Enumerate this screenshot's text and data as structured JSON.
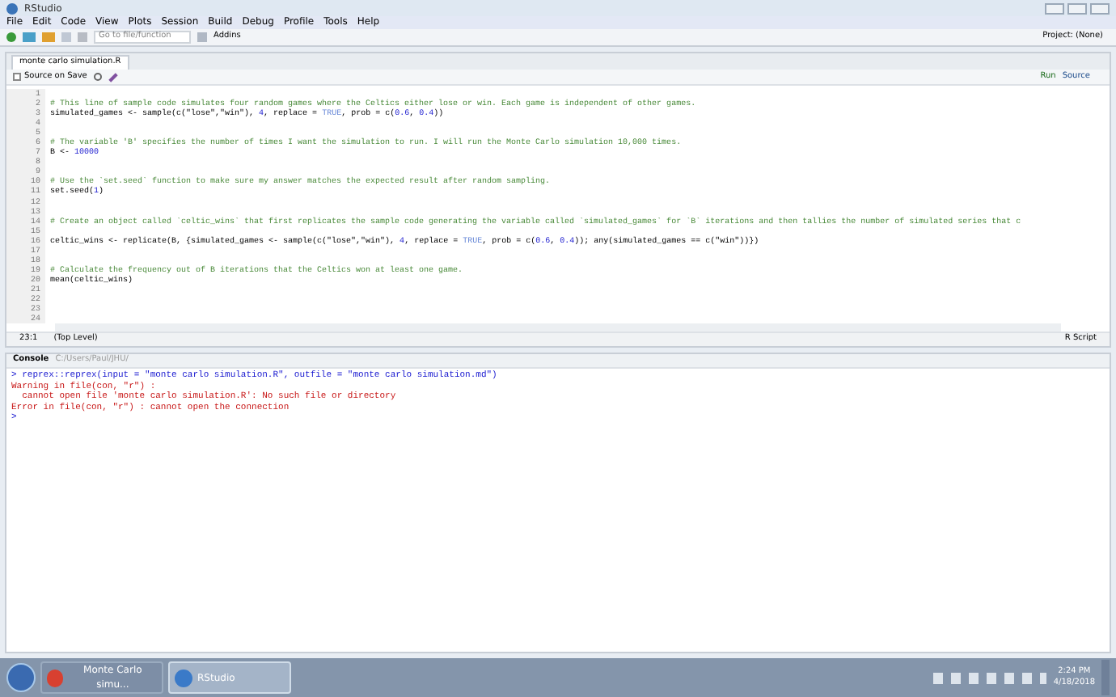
{
  "window": {
    "title": "RStudio"
  },
  "menu": [
    "File",
    "Edit",
    "Code",
    "View",
    "Plots",
    "Session",
    "Build",
    "Debug",
    "Profile",
    "Tools",
    "Help"
  ],
  "toolbar": {
    "goto_placeholder": "Go to file/function",
    "addins": "Addins",
    "project": "Project: (None)"
  },
  "editor": {
    "tab": {
      "label": "monte carlo simulation.R",
      "selected": true
    },
    "source_on_save": {
      "label": "Source on Save",
      "checked": false
    },
    "run": "Run",
    "source": "Source",
    "lines": [
      {
        "number": "1"
      },
      {
        "number": "2",
        "segments": [
          {
            "kind": "comment",
            "text": "# This line of sample code simulates four random games where the Celtics either lose or win. Each game is independent of other games."
          }
        ]
      },
      {
        "number": "3",
        "segments": [
          {
            "kind": "code",
            "text": "simulated_games <- sample(c(\"lose\",\"win\"), "
          },
          {
            "kind": "number",
            "text": "4"
          },
          {
            "kind": "code",
            "text": ", replace = "
          },
          {
            "kind": "constant",
            "text": "TRUE"
          },
          {
            "kind": "code",
            "text": ", prob = c("
          },
          {
            "kind": "number",
            "text": "0.6"
          },
          {
            "kind": "code",
            "text": ", "
          },
          {
            "kind": "number",
            "text": "0.4"
          },
          {
            "kind": "code",
            "text": "))"
          }
        ]
      },
      {
        "number": "4"
      },
      {
        "number": "5"
      },
      {
        "number": "6",
        "segments": [
          {
            "kind": "comment",
            "text": "# The variable 'B' specifies the number of times I want the simulation to run. I will run the Monte Carlo simulation 10,000 times."
          }
        ]
      },
      {
        "number": "7",
        "segments": [
          {
            "kind": "code",
            "text": "B <- "
          },
          {
            "kind": "number",
            "text": "10000"
          }
        ]
      },
      {
        "number": "8"
      },
      {
        "number": "9"
      },
      {
        "number": "10",
        "segments": [
          {
            "kind": "comment",
            "text": "# Use the `set.seed` function to make sure my answer matches the expected result after random sampling."
          }
        ]
      },
      {
        "number": "11",
        "segments": [
          {
            "kind": "code",
            "text": "set.seed("
          },
          {
            "kind": "number",
            "text": "1"
          },
          {
            "kind": "code",
            "text": ")"
          }
        ]
      },
      {
        "number": "12"
      },
      {
        "number": "13"
      },
      {
        "number": "14",
        "segments": [
          {
            "kind": "comment",
            "text": "# Create an object called `celtic_wins` that first replicates the sample code generating the variable called `simulated_games` for `B` iterations and then tallies the number of simulated series that c"
          }
        ]
      },
      {
        "number": "15"
      },
      {
        "number": "16",
        "segments": [
          {
            "kind": "code",
            "text": "celtic_wins <- replicate(B, {simulated_games <- sample(c(\"lose\",\"win\"), "
          },
          {
            "kind": "number",
            "text": "4"
          },
          {
            "kind": "code",
            "text": ", replace = "
          },
          {
            "kind": "constant",
            "text": "TRUE"
          },
          {
            "kind": "code",
            "text": ", prob = c("
          },
          {
            "kind": "number",
            "text": "0.6"
          },
          {
            "kind": "code",
            "text": ", "
          },
          {
            "kind": "number",
            "text": "0.4"
          },
          {
            "kind": "code",
            "text": ")); any(simulated_games == c(\"win\"))})"
          }
        ]
      },
      {
        "number": "17"
      },
      {
        "number": "18"
      },
      {
        "number": "19",
        "segments": [
          {
            "kind": "comment",
            "text": "# Calculate the frequency out of B iterations that the Celtics won at least one game."
          }
        ]
      },
      {
        "number": "20",
        "segments": [
          {
            "kind": "code",
            "text": "mean(celtic_wins)"
          }
        ]
      },
      {
        "number": "21"
      },
      {
        "number": "22"
      },
      {
        "number": "23"
      },
      {
        "number": "24"
      }
    ],
    "status": {
      "position": "23:1",
      "scope": "(Top Level)",
      "file_type": "R Script"
    }
  },
  "console": {
    "title": "Console",
    "path": "C:/Users/Paul/JHU/",
    "lines": [
      {
        "kind": "input",
        "text": "> reprex::reprex(input = \"monte carlo simulation.R\", outfile = \"monte carlo simulation.md\")"
      },
      {
        "kind": "error",
        "text": "Warning in file(con, \"r\") :"
      },
      {
        "kind": "error",
        "text": "  cannot open file 'monte carlo simulation.R': No such file or directory"
      },
      {
        "kind": "error",
        "text": "Error in file(con, \"r\") : cannot open the connection"
      },
      {
        "kind": "input",
        "text": ">"
      }
    ]
  },
  "taskbar": {
    "items": [
      {
        "label": "Monte Carlo simu...",
        "selected": false
      },
      {
        "label": "RStudio",
        "selected": true
      }
    ],
    "time": "2:24 PM",
    "date": "4/18/2018"
  }
}
